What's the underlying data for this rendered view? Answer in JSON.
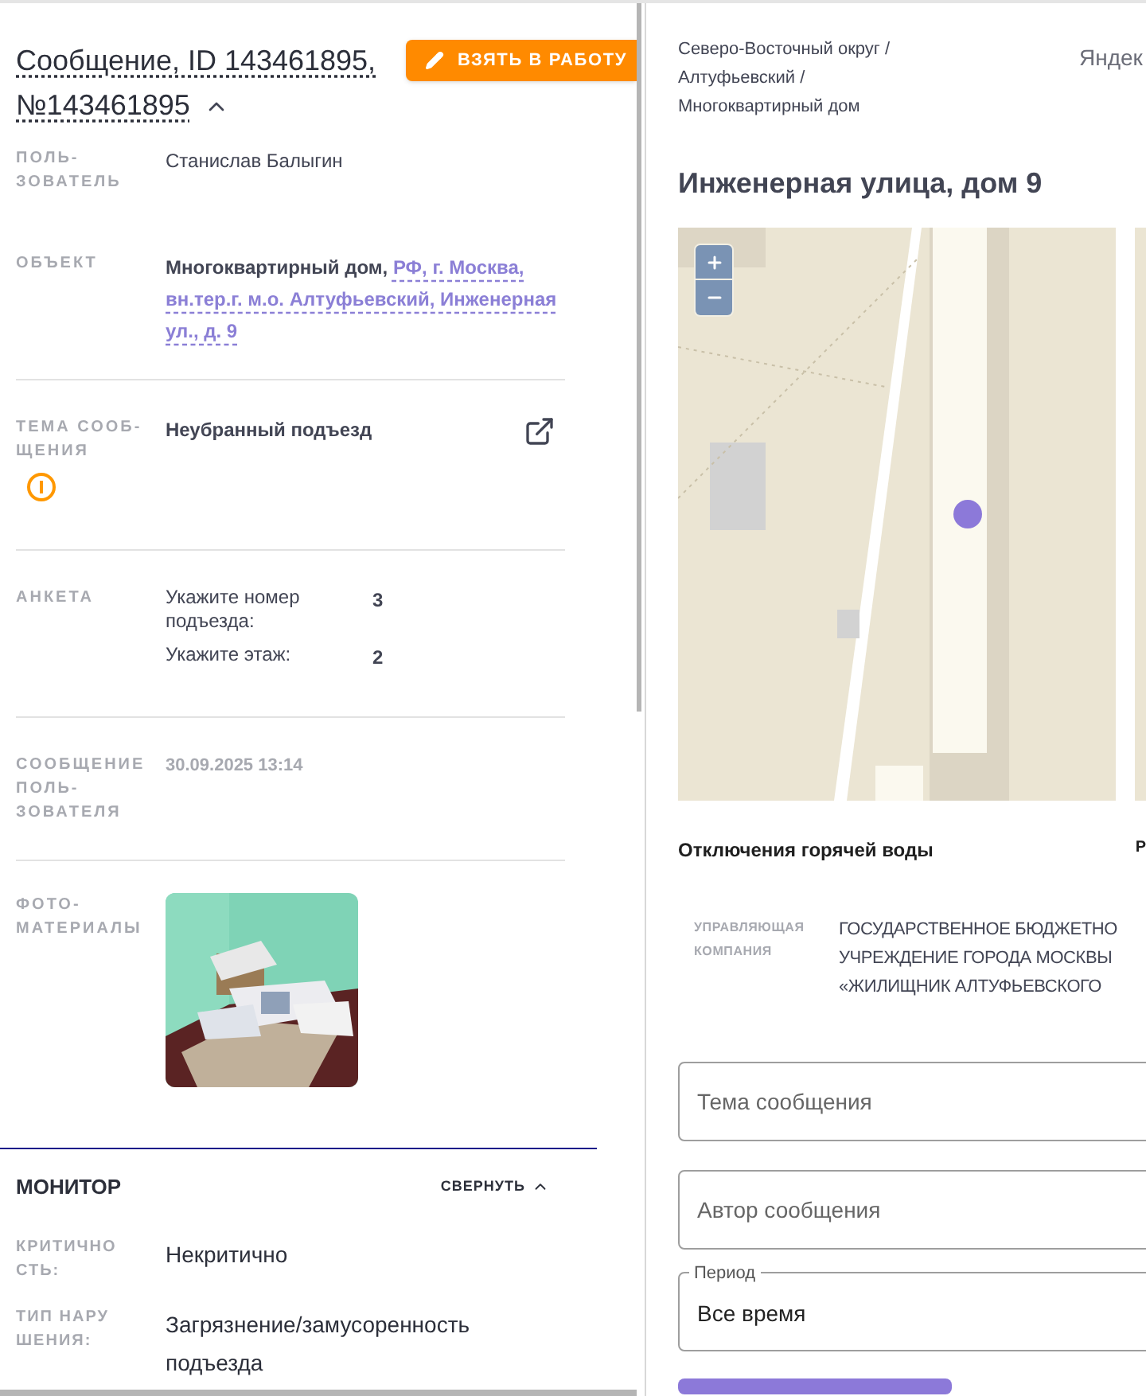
{
  "message": {
    "title": "Сообщение, ID 143461895, №143461895",
    "take_button": "ВЗЯТЬ В РАБОТУ",
    "expanded": true
  },
  "fields": [
    {
      "kind": "text",
      "label": "ПОЛЬ-ЗОВАТЕЛЬ",
      "value": "Станислав Балыгин"
    },
    {
      "kind": "object",
      "label": "ОБЪЕКТ",
      "value": "Многоквартирный дом,",
      "link": "РФ, г. Москва, вн.тер.г. м.о. Алтуфьевский, Инженерная ул., д. 9"
    },
    {
      "kind": "topic",
      "label": "ТЕМА СООБ-ЩЕНИЯ",
      "value": "Неубранный подъезд",
      "warning": true
    },
    {
      "kind": "survey",
      "label": "АНКЕТА",
      "items": [
        {
          "question": "Укажите номер подъезда:",
          "answer": "3"
        },
        {
          "question": "Укажите этаж:",
          "answer": "2"
        }
      ]
    },
    {
      "kind": "date",
      "label": "СООБЩЕНИЕ ПОЛЬ-ЗОВАТЕЛЯ",
      "value": "30.09.2025 13:14"
    },
    {
      "kind": "photos",
      "label": "ФОТО-МАТЕРИАЛЫ"
    }
  ],
  "monitor": {
    "title": "МОНИТОР",
    "toggle": "СВЕРНУТЬ",
    "expanded": true,
    "rows": [
      {
        "label": "КРИТИЧНОСТЬ:",
        "value": "Некритично"
      },
      {
        "label": "ТИП НАРУШЕНИЯ:",
        "value": "Загрязнение/замусоренность подъезда"
      }
    ]
  },
  "location": {
    "breadcrumb": [
      "Северо-Восточный округ /",
      "Алтуфьевский /",
      "Многоквартирный дом"
    ],
    "map_link": "Яндек",
    "heading": "Инженерная улица, дом 9"
  },
  "outages": {
    "title": "Отключения горячей воды",
    "column_2": "Р"
  },
  "management": {
    "label": "УПРАВЛЯЮЩАЯ КОМПАНИЯ",
    "lines": [
      "ГОСУДАРСТВЕННОЕ БЮДЖЕТНО",
      "УЧРЕЖДЕНИЕ ГОРОДА МОСКВЫ",
      "«ЖИЛИЩНИК АЛТУФЬЕВСКОГО"
    ]
  },
  "filters": [
    {
      "kind": "text",
      "placeholder": "Тема сообщения"
    },
    {
      "kind": "text",
      "placeholder": "Автор сообщения"
    },
    {
      "kind": "select",
      "label": "Период",
      "value": "Все время"
    }
  ]
}
